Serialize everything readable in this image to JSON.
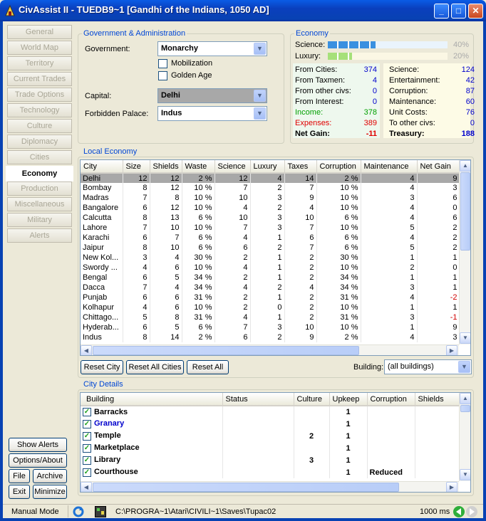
{
  "window": {
    "title": "CivAssist II - TUEDB9~1 [Gandhi of the Indians, 1050 AD]"
  },
  "nav": {
    "items": [
      "General",
      "World Map",
      "Territory",
      "Current Trades",
      "Trade Options",
      "Technology",
      "Culture",
      "Diplomacy",
      "Cities",
      "Economy",
      "Production",
      "Miscellaneous",
      "Military",
      "Alerts"
    ],
    "active": "Economy"
  },
  "bottom_buttons": {
    "show_alerts": "Show Alerts",
    "options_about": "Options/About",
    "file": "File",
    "archive": "Archive",
    "exit": "Exit",
    "minimize": "Minimize"
  },
  "government": {
    "group_title": "Government & Administration",
    "government_label": "Government:",
    "government_value": "Monarchy",
    "mobilization_label": "Mobilization",
    "golden_age_label": "Golden Age",
    "capital_label": "Capital:",
    "capital_value": "Delhi",
    "forbidden_palace_label": "Forbidden Palace:",
    "forbidden_palace_value": "Indus"
  },
  "economy": {
    "group_title": "Economy",
    "science_label": "Science:",
    "science_pct": "40%",
    "science_level": 0.4,
    "luxury_label": "Luxury:",
    "luxury_pct": "20%",
    "luxury_level": 0.2,
    "left": [
      {
        "label": "From Cities:",
        "value": "374"
      },
      {
        "label": "From Taxmen:",
        "value": "4"
      },
      {
        "label": "From other civs:",
        "value": "0"
      },
      {
        "label": "From Interest:",
        "value": "0"
      },
      {
        "label": "Income:",
        "value": "378"
      },
      {
        "label": "Expenses:",
        "value": "389"
      },
      {
        "label": "Net Gain:",
        "value": "-11"
      }
    ],
    "right": [
      {
        "label": "Science:",
        "value": "124"
      },
      {
        "label": "Entertainment:",
        "value": "42"
      },
      {
        "label": "Corruption:",
        "value": "87"
      },
      {
        "label": "Maintenance:",
        "value": "60"
      },
      {
        "label": "Unit Costs:",
        "value": "76"
      },
      {
        "label": "To other civs:",
        "value": "0"
      },
      {
        "label": "Treasury:",
        "value": "188"
      }
    ],
    "colors": {
      "income": "#00a000",
      "expenses": "#e00000",
      "values": "#0000cc",
      "science_bar": "#3a90e0",
      "luxury_bar": "#a6e07a"
    }
  },
  "local_economy": {
    "group_title": "Local Economy",
    "columns": [
      "City",
      "Size",
      "Shields",
      "Waste",
      "Science",
      "Luxury",
      "Taxes",
      "Corruption",
      "Maintenance",
      "Net Gain"
    ],
    "rows": [
      [
        "Delhi",
        "12",
        "12",
        "2 %",
        "12",
        "4",
        "14",
        "2 %",
        "4",
        "9"
      ],
      [
        "Bombay",
        "8",
        "12",
        "10 %",
        "7",
        "2",
        "7",
        "10 %",
        "4",
        "3"
      ],
      [
        "Madras",
        "7",
        "8",
        "10 %",
        "10",
        "3",
        "9",
        "10 %",
        "3",
        "6"
      ],
      [
        "Bangalore",
        "6",
        "12",
        "10 %",
        "4",
        "2",
        "4",
        "10 %",
        "4",
        "0"
      ],
      [
        "Calcutta",
        "8",
        "13",
        "6 %",
        "10",
        "3",
        "10",
        "6 %",
        "4",
        "6"
      ],
      [
        "Lahore",
        "7",
        "10",
        "10 %",
        "7",
        "3",
        "7",
        "10 %",
        "5",
        "2"
      ],
      [
        "Karachi",
        "6",
        "7",
        "6 %",
        "4",
        "1",
        "6",
        "6 %",
        "4",
        "2"
      ],
      [
        "Jaipur",
        "8",
        "10",
        "6 %",
        "6",
        "2",
        "7",
        "6 %",
        "5",
        "2"
      ],
      [
        "New Kol...",
        "3",
        "4",
        "30 %",
        "2",
        "1",
        "2",
        "30 %",
        "1",
        "1"
      ],
      [
        "Swordy ...",
        "4",
        "6",
        "10 %",
        "4",
        "1",
        "2",
        "10 %",
        "2",
        "0"
      ],
      [
        "Bengal",
        "6",
        "5",
        "34 %",
        "2",
        "1",
        "2",
        "34 %",
        "1",
        "1"
      ],
      [
        "Dacca",
        "7",
        "4",
        "34 %",
        "4",
        "2",
        "4",
        "34 %",
        "3",
        "1"
      ],
      [
        "Punjab",
        "6",
        "6",
        "31 %",
        "2",
        "1",
        "2",
        "31 %",
        "4",
        "-2"
      ],
      [
        "Kolhapur",
        "4",
        "6",
        "10 %",
        "2",
        "0",
        "2",
        "10 %",
        "1",
        "1"
      ],
      [
        "Chittago...",
        "5",
        "8",
        "31 %",
        "4",
        "1",
        "2",
        "31 %",
        "3",
        "-1"
      ],
      [
        "Hyderab...",
        "6",
        "5",
        "6 %",
        "7",
        "3",
        "10",
        "10 %",
        "1",
        "9"
      ],
      [
        "Indus",
        "8",
        "14",
        "2 %",
        "6",
        "2",
        "9",
        "2 %",
        "4",
        "3"
      ]
    ],
    "reset_city": "Reset City",
    "reset_all_cities": "Reset All Cities",
    "reset_all": "Reset All",
    "building_label": "Building:",
    "building_value": "(all buildings)"
  },
  "city_details": {
    "group_title": "City Details",
    "columns": [
      "Building",
      "Status",
      "Culture",
      "Upkeep",
      "Corruption",
      "Shields"
    ],
    "rows": [
      {
        "checked": true,
        "name": "Barracks",
        "status": "",
        "culture": "",
        "upkeep": "1",
        "corruption": "",
        "shields": "",
        "color": "#000000"
      },
      {
        "checked": true,
        "name": "Granary",
        "status": "",
        "culture": "",
        "upkeep": "1",
        "corruption": "",
        "shields": "",
        "color": "#0000cc"
      },
      {
        "checked": true,
        "name": "Temple",
        "status": "",
        "culture": "2",
        "upkeep": "1",
        "corruption": "",
        "shields": "",
        "color": "#000000"
      },
      {
        "checked": true,
        "name": "Marketplace",
        "status": "",
        "culture": "",
        "upkeep": "1",
        "corruption": "",
        "shields": "",
        "color": "#000000"
      },
      {
        "checked": true,
        "name": "Library",
        "status": "",
        "culture": "3",
        "upkeep": "1",
        "corruption": "",
        "shields": "",
        "color": "#000000"
      },
      {
        "checked": true,
        "name": "Courthouse",
        "status": "",
        "culture": "",
        "upkeep": "1",
        "corruption": "Reduced",
        "shields": "",
        "color": "#000000"
      }
    ]
  },
  "statusbar": {
    "mode": "Manual Mode",
    "path": "C:\\PROGRA~1\\Atari\\CIVILI~1\\Saves\\Tupac02",
    "interval": "1000 ms"
  }
}
